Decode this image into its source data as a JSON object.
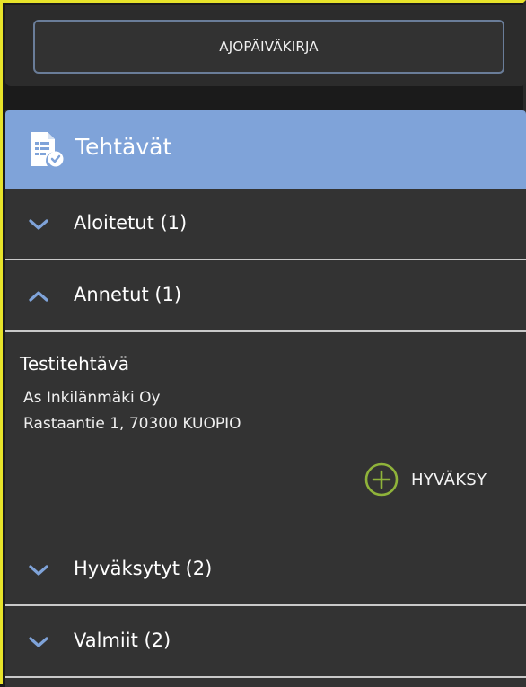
{
  "log_button": {
    "label": "AJOPÄIVÄKIRJA"
  },
  "panel": {
    "title": "Tehtävät",
    "header_color": "#7fa3d9",
    "sections": [
      {
        "label": "Aloitetut (1)",
        "expanded": false,
        "icon": "chevron-down-icon"
      },
      {
        "label": "Annetut (1)",
        "expanded": true,
        "icon": "chevron-up-icon"
      },
      {
        "label": "Hyväksytyt (2)",
        "expanded": false,
        "icon": "chevron-down-icon"
      },
      {
        "label": "Valmiit (2)",
        "expanded": false,
        "icon": "chevron-down-icon"
      }
    ]
  },
  "task": {
    "title": "Testitehtävä",
    "company": "As Inkilänmäki Oy",
    "address": "Rastaantie 1, 70300 KUOPIO",
    "accept_label": "HYVÄKSY",
    "accept_color": "#8fb33a"
  }
}
